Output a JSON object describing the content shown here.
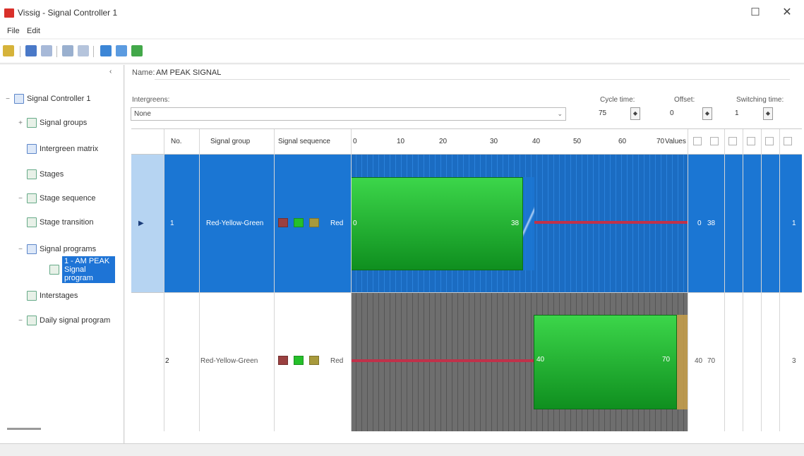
{
  "window": {
    "title": "Vissig - Signal Controller 1",
    "maximize_glyph": "☐",
    "close_glyph": "✕"
  },
  "menu": {
    "items": [
      "File",
      "Edit"
    ]
  },
  "toolbar": {
    "icons": [
      "save-icon",
      "undo-icon",
      "redo-icon",
      "cut-icon",
      "paste-icon",
      "chart-icon",
      "table-icon",
      "settings-icon"
    ]
  },
  "tree": {
    "collapse_glyph": "‹",
    "items": [
      {
        "label": "Signal Controller 1",
        "toggle": "−",
        "icon": "controller-icon"
      },
      {
        "label": "Signal groups",
        "toggle": "+",
        "icon": "signal-groups-icon"
      },
      {
        "label": "Intergreen matrix",
        "toggle": "",
        "icon": "matrix-icon"
      },
      {
        "label": "Stages",
        "toggle": "",
        "icon": "stages-icon"
      },
      {
        "label": "Stage sequence",
        "toggle": "−",
        "icon": "stage-sequence-icon"
      },
      {
        "label": "Stage transition",
        "toggle": "",
        "icon": "stage-transition-icon"
      },
      {
        "label": "Signal programs",
        "toggle": "−",
        "icon": "signal-programs-icon"
      },
      {
        "label": "1 - AM PEAK Signal program",
        "toggle": "",
        "icon": "signal-program-icon"
      },
      {
        "label": "Interstages",
        "toggle": "",
        "icon": "interstages-icon"
      },
      {
        "label": "Daily signal program",
        "toggle": "−",
        "icon": "daily-icon"
      }
    ]
  },
  "program": {
    "name_label": "Name:",
    "name_value": "AM PEAK SIGNAL",
    "intergreens_label": "Intergreens:",
    "intergreens_value": "None",
    "cycle_time_label": "Cycle time:",
    "cycle_time_value": "75",
    "offset_label": "Offset:",
    "offset_value": "0",
    "switching_label": "Switching time:",
    "switching_value": "1"
  },
  "grid": {
    "headers": {
      "no": "No.",
      "signal_group": "Signal group",
      "sequence": "Signal sequence",
      "ticks": [
        "0",
        "10",
        "20",
        "30",
        "40",
        "50",
        "60",
        "70"
      ],
      "last_tick": "Values"
    },
    "header_swatches": [
      "#8e3b3b",
      "#25c02a",
      "#8e3b3b",
      "#25c02a",
      "#b43a2a",
      "#a89a3c"
    ],
    "rows": [
      {
        "arrow": "▶",
        "no": "1",
        "signal_group": "Red-Yellow-Green",
        "seq_text": "Red",
        "green_start": "0",
        "green_end": "38",
        "value_a": "0",
        "value_b": "38",
        "tail": "1",
        "seq_colors": [
          "#9a4040",
          "#25c02a",
          "#a89a3c"
        ]
      },
      {
        "no": "2",
        "signal_group": "Red-Yellow-Green",
        "seq_text": "Red",
        "green_start": "40",
        "green_end": "70",
        "value_a": "40",
        "value_b": "70",
        "tail": "3",
        "seq_colors": [
          "#9a4040",
          "#25c02a",
          "#a89a3c"
        ]
      }
    ]
  },
  "colors": {
    "selection": "#1b76d3",
    "green": "#25c02a",
    "red": "#c0324a",
    "amber": "#c8a04a"
  }
}
